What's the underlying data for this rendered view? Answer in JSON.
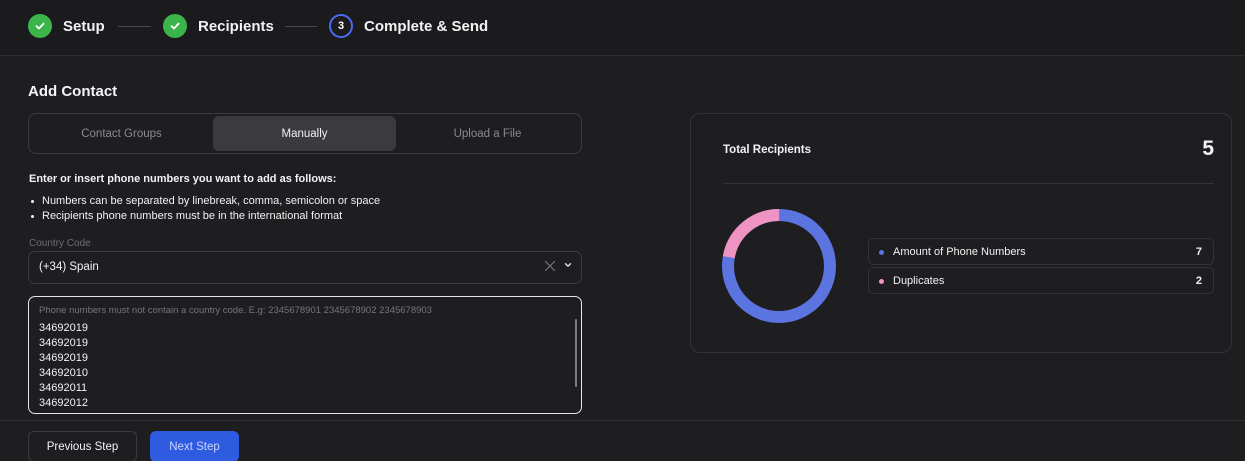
{
  "stepper": {
    "steps": [
      {
        "label": "Setup",
        "status": "done"
      },
      {
        "label": "Recipients",
        "status": "done"
      },
      {
        "label": "Complete & Send",
        "status": "current",
        "number": "3"
      }
    ]
  },
  "section_title": "Add Contact",
  "tabs": [
    {
      "label": "Contact Groups",
      "active": false
    },
    {
      "label": "Manually",
      "active": true
    },
    {
      "label": "Upload a File",
      "active": false
    }
  ],
  "instructions": {
    "heading": "Enter or insert phone numbers you want to add as follows:",
    "bullets": [
      "Numbers can be separated by linebreak, comma, semicolon or space",
      "Recipients phone numbers must be in the international format"
    ]
  },
  "country_code": {
    "label": "Country Code",
    "value": "(+34) Spain"
  },
  "phone_input": {
    "placeholder": "Phone numbers must not contain a country code. E.g: 2345678901 2345678902 2345678903",
    "lines": [
      "34692019",
      "34692019",
      "34692019",
      "34692010",
      "34692011",
      "34692012"
    ]
  },
  "footer": {
    "previous_label": "Previous Step",
    "next_label": "Next Step"
  },
  "summary": {
    "title": "Total Recipients",
    "total": "5",
    "legend": [
      {
        "label": "Amount of Phone Numbers",
        "value": "7",
        "color": "#5b74e0"
      },
      {
        "label": "Duplicates",
        "value": "2",
        "color": "#ee93c2"
      }
    ]
  },
  "colors": {
    "accent": "#2f5be0",
    "done": "#3bb54a",
    "current_ring": "#4a6cf0"
  }
}
